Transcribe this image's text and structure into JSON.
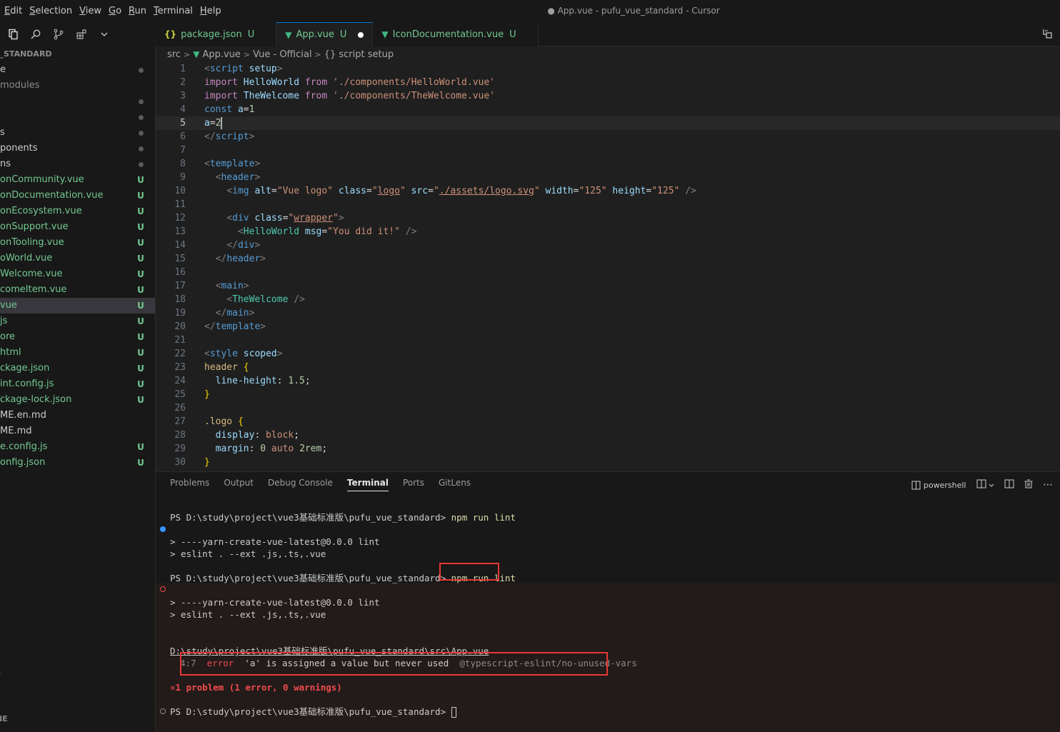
{
  "menu": [
    {
      "u": "E",
      "rest": "dit"
    },
    {
      "u": "S",
      "rest": "election"
    },
    {
      "u": "V",
      "rest": "iew"
    },
    {
      "u": "G",
      "rest": "o"
    },
    {
      "u": "R",
      "rest": "un"
    },
    {
      "u": "T",
      "rest": "erminal"
    },
    {
      "u": "H",
      "rest": "elp"
    }
  ],
  "window_title": "● App.vue - pufu_vue_standard - Cursor",
  "sidebar": {
    "header": "E_STANDARD",
    "items": [
      {
        "label": "e",
        "status": "dot"
      },
      {
        "label": "modules",
        "status": "",
        "dim": true
      },
      {
        "label": "",
        "status": "dot"
      },
      {
        "label": "",
        "status": "dot"
      },
      {
        "label": "s",
        "status": "dot"
      },
      {
        "label": "ponents",
        "status": "dot"
      },
      {
        "label": "ns",
        "status": "dot"
      },
      {
        "label": "onCommunity.vue",
        "status": "U"
      },
      {
        "label": "onDocumentation.vue",
        "status": "U"
      },
      {
        "label": "onEcosystem.vue",
        "status": "U"
      },
      {
        "label": "onSupport.vue",
        "status": "U"
      },
      {
        "label": "onTooling.vue",
        "status": "U"
      },
      {
        "label": "oWorld.vue",
        "status": "U"
      },
      {
        "label": "Welcome.vue",
        "status": "U"
      },
      {
        "label": "comeItem.vue",
        "status": "U"
      },
      {
        "label": "vue",
        "status": "U",
        "selected": true
      },
      {
        "label": "js",
        "status": "U"
      },
      {
        "label": "ore",
        "status": "U"
      },
      {
        "label": "html",
        "status": "U"
      },
      {
        "label": "ckage.json",
        "status": "U"
      },
      {
        "label": "int.config.js",
        "status": "U"
      },
      {
        "label": "ckage-lock.json",
        "status": "U"
      },
      {
        "label": "ME.en.md",
        "status": "",
        "plain": true
      },
      {
        "label": "ME.md",
        "status": "",
        "plain": true
      },
      {
        "label": "e.config.js",
        "status": "U"
      },
      {
        "label": "onfig.json",
        "status": "U"
      }
    ],
    "side_label": "S",
    "bottom_label": "NE"
  },
  "tabs": [
    {
      "icon": "{}",
      "label": "package.json",
      "status": "U",
      "active": false
    },
    {
      "icon": "V",
      "label": "App.vue",
      "status": "U",
      "active": true,
      "dirty": true
    },
    {
      "icon": "V",
      "label": "IconDocumentation.vue",
      "status": "U",
      "active": false
    }
  ],
  "breadcrumb": [
    "src",
    "App.vue",
    "Vue - Official",
    "{} script setup"
  ],
  "code_lines": [
    [
      [
        "tk-br",
        "<"
      ],
      [
        "tk-tag",
        "script"
      ],
      [
        "tk-attr",
        " setup"
      ],
      [
        "tk-br",
        ">"
      ]
    ],
    [
      [
        "tk-kw",
        "import"
      ],
      [
        "tk-var",
        " HelloWorld"
      ],
      [
        "tk-kw",
        " from"
      ],
      [
        "tk-str",
        " './components/HelloWorld.vue'"
      ]
    ],
    [
      [
        "tk-kw",
        "import"
      ],
      [
        "tk-var",
        " TheWelcome"
      ],
      [
        "tk-kw",
        " from"
      ],
      [
        "tk-str",
        " './components/TheWelcome.vue'"
      ]
    ],
    [
      [
        "tk-tag",
        "const"
      ],
      [
        "tk-var",
        " a"
      ],
      [
        "tk-plain",
        "="
      ],
      [
        "tk-num",
        "1"
      ]
    ],
    [
      [
        "tk-var",
        "a"
      ],
      [
        "tk-plain",
        "="
      ],
      [
        "tk-num",
        "2"
      ]
    ],
    [
      [
        "tk-br",
        "</"
      ],
      [
        "tk-tag",
        "script"
      ],
      [
        "tk-br",
        ">"
      ]
    ],
    [],
    [
      [
        "tk-br",
        "<"
      ],
      [
        "tk-tag",
        "template"
      ],
      [
        "tk-br",
        ">"
      ]
    ],
    [
      [
        "tk-plain",
        "  "
      ],
      [
        "tk-br",
        "<"
      ],
      [
        "tk-tag",
        "header"
      ],
      [
        "tk-br",
        ">"
      ]
    ],
    [
      [
        "tk-plain",
        "    "
      ],
      [
        "tk-br",
        "<"
      ],
      [
        "tk-tag",
        "img"
      ],
      [
        "tk-attr",
        " alt"
      ],
      [
        "tk-plain",
        "="
      ],
      [
        "tk-str",
        "\"Vue logo\""
      ],
      [
        "tk-attr",
        " class"
      ],
      [
        "tk-plain",
        "="
      ],
      [
        "tk-str",
        "\""
      ],
      [
        "tk-url",
        "logo"
      ],
      [
        "tk-str",
        "\""
      ],
      [
        "tk-attr",
        " src"
      ],
      [
        "tk-plain",
        "="
      ],
      [
        "tk-str",
        "\""
      ],
      [
        "tk-url",
        "./assets/logo.svg"
      ],
      [
        "tk-str",
        "\""
      ],
      [
        "tk-attr",
        " width"
      ],
      [
        "tk-plain",
        "="
      ],
      [
        "tk-str",
        "\"125\""
      ],
      [
        "tk-attr",
        " height"
      ],
      [
        "tk-plain",
        "="
      ],
      [
        "tk-str",
        "\"125\""
      ],
      [
        "tk-br",
        " />"
      ]
    ],
    [],
    [
      [
        "tk-plain",
        "    "
      ],
      [
        "tk-br",
        "<"
      ],
      [
        "tk-tag",
        "div"
      ],
      [
        "tk-attr",
        " class"
      ],
      [
        "tk-plain",
        "="
      ],
      [
        "tk-str",
        "\""
      ],
      [
        "tk-url",
        "wrapper"
      ],
      [
        "tk-str",
        "\""
      ],
      [
        "tk-br",
        ">"
      ]
    ],
    [
      [
        "tk-plain",
        "      "
      ],
      [
        "tk-br",
        "<"
      ],
      [
        "tk-comp",
        "HelloWorld"
      ],
      [
        "tk-attr",
        " msg"
      ],
      [
        "tk-plain",
        "="
      ],
      [
        "tk-str",
        "\"You did it!\""
      ],
      [
        "tk-br",
        " />"
      ]
    ],
    [
      [
        "tk-plain",
        "    "
      ],
      [
        "tk-br",
        "</"
      ],
      [
        "tk-tag",
        "div"
      ],
      [
        "tk-br",
        ">"
      ]
    ],
    [
      [
        "tk-plain",
        "  "
      ],
      [
        "tk-br",
        "</"
      ],
      [
        "tk-tag",
        "header"
      ],
      [
        "tk-br",
        ">"
      ]
    ],
    [],
    [
      [
        "tk-plain",
        "  "
      ],
      [
        "tk-br",
        "<"
      ],
      [
        "tk-tag",
        "main"
      ],
      [
        "tk-br",
        ">"
      ]
    ],
    [
      [
        "tk-plain",
        "    "
      ],
      [
        "tk-br",
        "<"
      ],
      [
        "tk-comp",
        "TheWelcome"
      ],
      [
        "tk-br",
        " />"
      ]
    ],
    [
      [
        "tk-plain",
        "  "
      ],
      [
        "tk-br",
        "</"
      ],
      [
        "tk-tag",
        "main"
      ],
      [
        "tk-br",
        ">"
      ]
    ],
    [
      [
        "tk-br",
        "</"
      ],
      [
        "tk-tag",
        "template"
      ],
      [
        "tk-br",
        ">"
      ]
    ],
    [],
    [
      [
        "tk-br",
        "<"
      ],
      [
        "tk-tag",
        "style"
      ],
      [
        "tk-attr",
        " scoped"
      ],
      [
        "tk-br",
        ">"
      ]
    ],
    [
      [
        "tk-sel",
        "header"
      ],
      [
        "tk-brace",
        " {"
      ]
    ],
    [
      [
        "tk-plain",
        "  "
      ],
      [
        "tk-prop",
        "line-height"
      ],
      [
        "tk-plain",
        ": "
      ],
      [
        "tk-num",
        "1.5"
      ],
      [
        "tk-plain",
        ";"
      ]
    ],
    [
      [
        "tk-brace",
        "}"
      ]
    ],
    [],
    [
      [
        "tk-sel",
        ".logo"
      ],
      [
        "tk-brace",
        " {"
      ]
    ],
    [
      [
        "tk-plain",
        "  "
      ],
      [
        "tk-prop",
        "display"
      ],
      [
        "tk-plain",
        ": "
      ],
      [
        "tk-str",
        "block"
      ],
      [
        "tk-plain",
        ";"
      ]
    ],
    [
      [
        "tk-plain",
        "  "
      ],
      [
        "tk-prop",
        "margin"
      ],
      [
        "tk-plain",
        ": "
      ],
      [
        "tk-num",
        "0"
      ],
      [
        "tk-str",
        " auto"
      ],
      [
        "tk-num",
        " 2rem"
      ],
      [
        "tk-plain",
        ";"
      ]
    ],
    [
      [
        "tk-brace",
        "}"
      ]
    ]
  ],
  "current_line": 5,
  "panel": {
    "tabs": [
      "Problems",
      "Output",
      "Debug Console",
      "Terminal",
      "Ports",
      "GitLens"
    ],
    "active_tab": "Terminal",
    "shell_label": "powershell"
  },
  "terminal": {
    "prompt": "PS D:\\study\\project\\vue3基础标准版\\pufu_vue_standard> ",
    "cmd1": "npm run lint",
    "out1a": "> ----yarn-create-vue-latest@0.0.0 lint",
    "out1b": "> eslint . --ext .js,.ts,.vue",
    "cmd2": "npm run lint",
    "out2a": "> ----yarn-create-vue-latest@0.0.0 lint",
    "out2b": "> eslint . --ext .js,.ts,.vue",
    "file_path": "D:\\study\\project\\vue3基础标准版\\pufu_vue_standard\\src\\App.vue",
    "err_pos": "4:7",
    "err_level": "error",
    "err_msg": "'a' is assigned a value but never used",
    "err_rule": "@typescript-eslint/no-unused-vars",
    "summary_icon": "✕",
    "summary": "1 problem (1 error, 0 warnings)",
    "prompt_last": "PS D:\\study\\project\\vue3基础标准版\\pufu_vue_standard> "
  },
  "colors": {
    "accent": "#0078d4",
    "untracked": "#73c991",
    "error": "#f14c4c",
    "annotation_box": "#e53935"
  }
}
